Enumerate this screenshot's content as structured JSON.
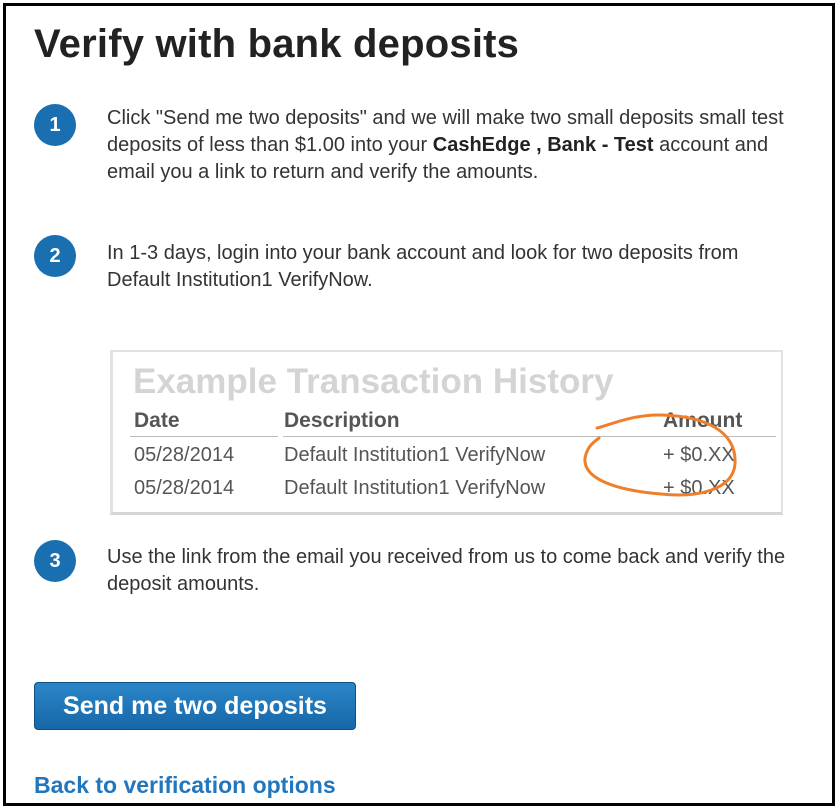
{
  "page": {
    "title": "Verify with bank deposits"
  },
  "steps": [
    {
      "number": "1",
      "text_before": "Click \"Send me two deposits\" and we will make two small deposits small test deposits of less than $1.00 into your ",
      "account_name": "CashEdge , Bank - Test",
      "text_after": " account and email you a link to return and verify the amounts."
    },
    {
      "number": "2",
      "text": "In 1-3 days, login into your bank account and look for two deposits from Default Institution1 VerifyNow."
    },
    {
      "number": "3",
      "text": "Use the link from the email you received from us to come back and verify the deposit amounts."
    }
  ],
  "example": {
    "title": "Example Transaction History",
    "headers": {
      "date": "Date",
      "description": "Description",
      "amount": "Amount"
    },
    "rows": [
      {
        "date": "05/28/2014",
        "description": "Default Institution1 VerifyNow",
        "amount": "+ $0.XX"
      },
      {
        "date": "05/28/2014",
        "description": "Default Institution1 VerifyNow",
        "amount": "+ $0.XX"
      }
    ],
    "highlight_color": "#f07f2c"
  },
  "actions": {
    "send_label": "Send me two deposits",
    "back_label": "Back to verification options"
  },
  "colors": {
    "accent": "#1a6fb0",
    "link": "#2176bd",
    "button": "#1d72b6"
  }
}
